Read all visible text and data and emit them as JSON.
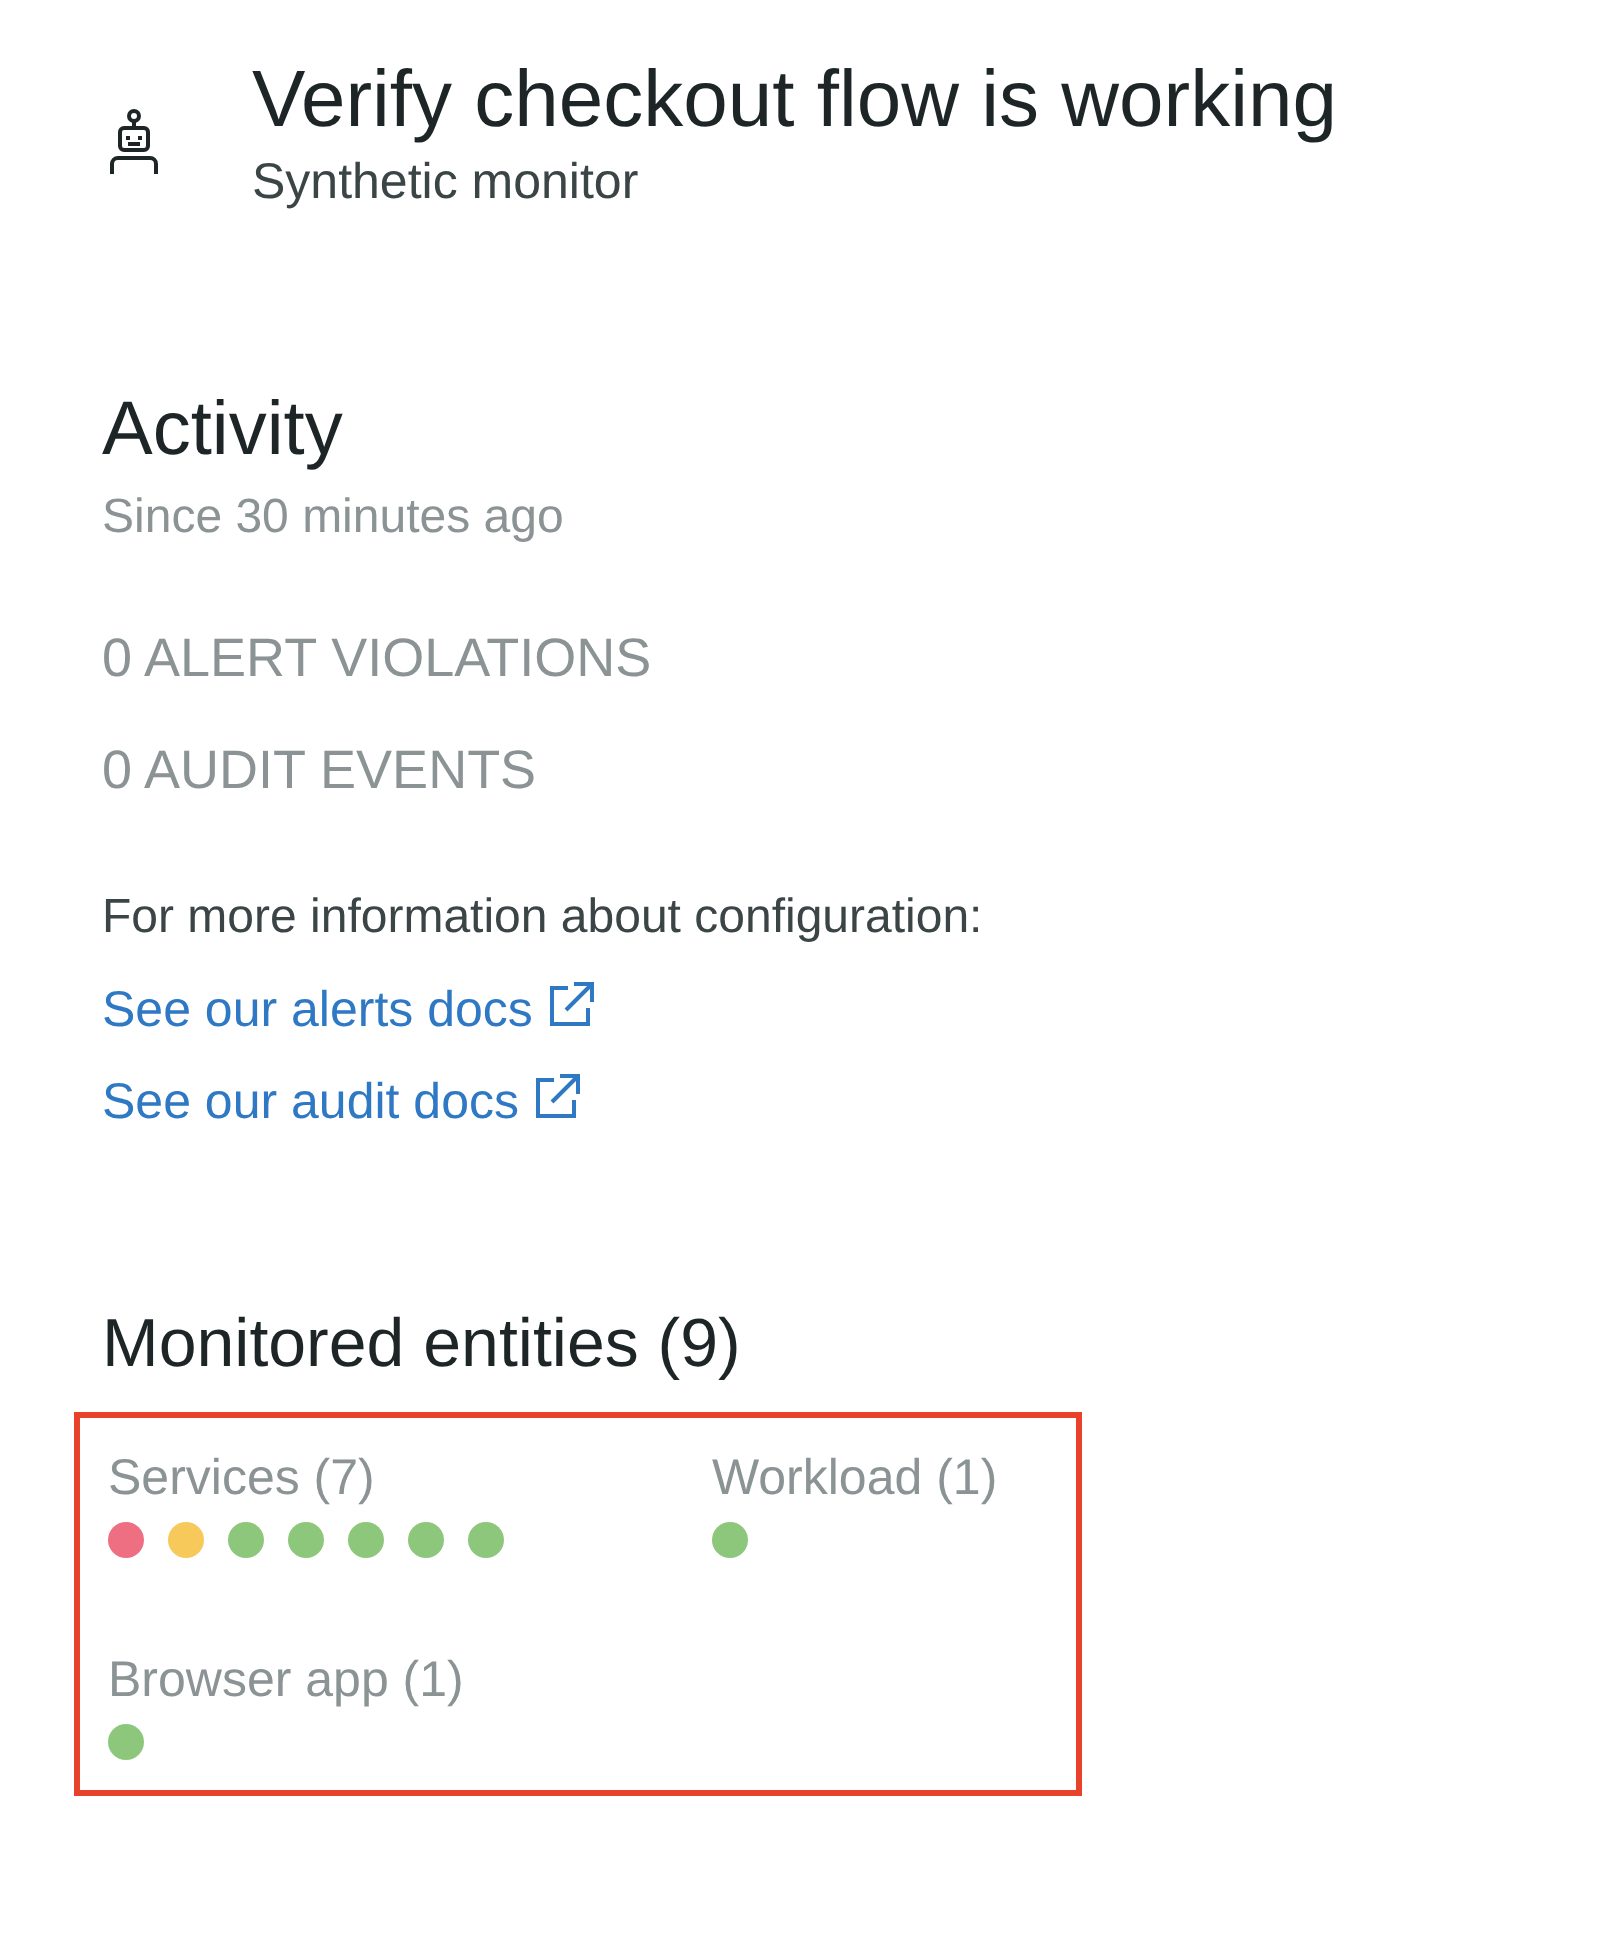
{
  "header": {
    "title": "Verify checkout flow is working",
    "subtitle": "Synthetic monitor"
  },
  "activity": {
    "heading": "Activity",
    "period": "Since 30 minutes ago",
    "counts": [
      "0 ALERT VIOLATIONS",
      "0 AUDIT EVENTS"
    ],
    "info": "For more information about configuration:",
    "links": [
      "See our alerts docs",
      "See our audit docs"
    ]
  },
  "entities": {
    "heading": "Monitored entities (9)",
    "highlighted": true,
    "groups": [
      {
        "label": "Services (7)",
        "dots": [
          {
            "color": "#ef6f82"
          },
          {
            "color": "#f7c85a"
          },
          {
            "color": "#8dc77b"
          },
          {
            "color": "#8dc77b"
          },
          {
            "color": "#8dc77b"
          },
          {
            "color": "#8dc77b"
          },
          {
            "color": "#8dc77b"
          }
        ]
      },
      {
        "label": "Workload (1)",
        "dots": [
          {
            "color": "#8dc77b"
          }
        ]
      },
      {
        "label": "Browser app (1)",
        "dots": [
          {
            "color": "#8dc77b"
          }
        ]
      }
    ]
  }
}
